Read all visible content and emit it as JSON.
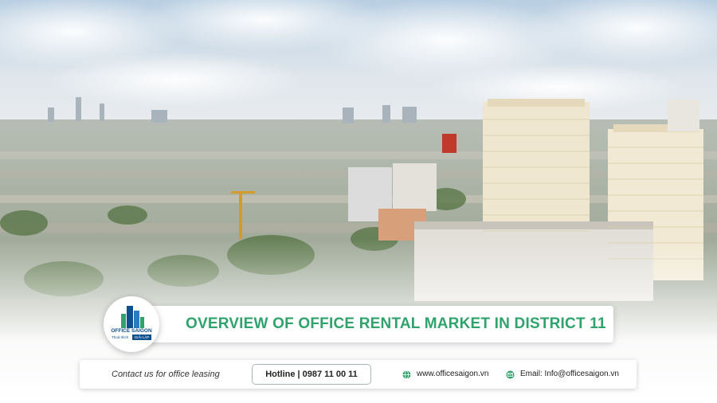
{
  "banner": {
    "title": "OVERVIEW OF OFFICE RENTAL MARKET IN DISTRICT 11"
  },
  "logo": {
    "brand": "OFFICE SAIGON",
    "tagline": "Thoả thích",
    "tagline_highlight": "GIẢI LẬP",
    "icon": "city-skyline-logo-icon"
  },
  "contact": {
    "label": "Contact us for office leasing",
    "hotline": "Hotline | 0987 11 00 11",
    "website": "www.officesaigon.vn",
    "email": "Email: Info@officesaigon.vn",
    "website_icon": "globe-icon",
    "email_icon": "mail-icon"
  },
  "colors": {
    "accent_green": "#2fa36b",
    "brand_blue": "#0e4f8e"
  }
}
